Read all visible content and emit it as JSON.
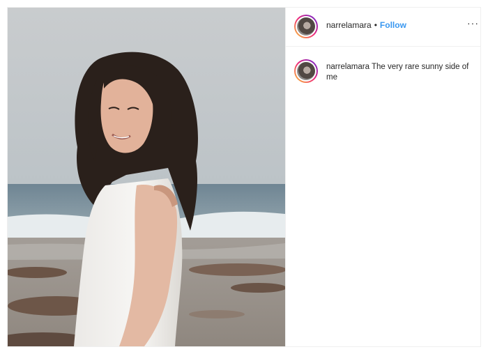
{
  "post": {
    "username": "narrelamara",
    "separator": "•",
    "follow_label": "Follow",
    "more_label": "···",
    "caption_username": "narrelamara",
    "caption_text": "The very rare sunny side of me"
  }
}
